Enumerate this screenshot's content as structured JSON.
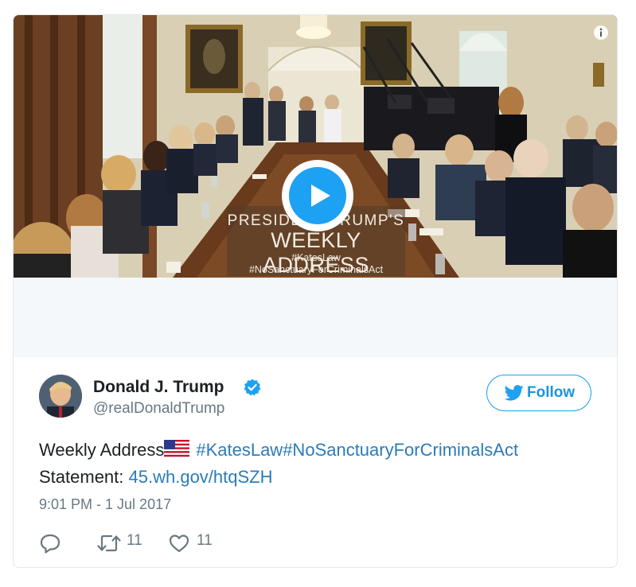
{
  "media": {
    "overlay": {
      "line1": "PRESIDENT TRUMP'S",
      "line2": "WEEKLY ADDRESS",
      "line3": "#KatesLaw",
      "line4": "#NoSanctuaryForCriminalsAct"
    },
    "info_icon": "info-icon",
    "play_icon": "play-icon"
  },
  "author": {
    "display_name": "Donald J. Trump",
    "handle": "@realDonaldTrump",
    "verified": true
  },
  "follow_button": {
    "label": "Follow",
    "icon": "twitter-bird-icon"
  },
  "tweet": {
    "text_prefix": "Weekly Address",
    "flag_icon": "us-flag-icon",
    "hashtags": "#KatesLaw#NoSanctuaryForCriminalsAct",
    "statement_label": "Statement: ",
    "link": "45.wh.gov/htqSZH",
    "timestamp": "9:01 PM - 1 Jul 2017"
  },
  "actions": {
    "reply": {
      "icon": "reply-icon"
    },
    "retweet": {
      "icon": "retweet-icon",
      "count": "11"
    },
    "like": {
      "icon": "heart-icon",
      "count": "11"
    }
  },
  "colors": {
    "accent": "#1da1f2",
    "link": "#2b7bb9",
    "secondary_text": "#697882",
    "border": "#e1e8ed"
  }
}
